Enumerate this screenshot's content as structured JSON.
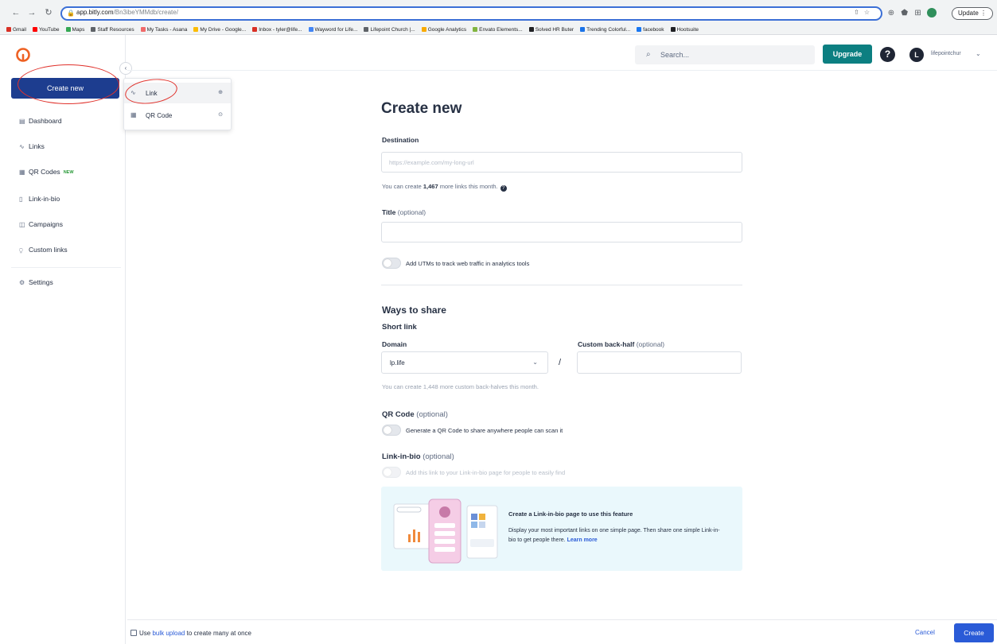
{
  "browser": {
    "url_host": "app.bitly.com",
    "url_path": "/Bn3ibeYMMdb/create/",
    "update_label": "Update",
    "bookmarks": [
      {
        "label": "Gmail",
        "color": "#d93025"
      },
      {
        "label": "YouTube",
        "color": "#ff0000"
      },
      {
        "label": "Maps",
        "color": "#34a853"
      },
      {
        "label": "Staff Resources",
        "color": "#5f6368"
      },
      {
        "label": "My Tasks - Asana",
        "color": "#f06a6a"
      },
      {
        "label": "My Drive - Google...",
        "color": "#fbbc04"
      },
      {
        "label": "Inbox - tyler@life...",
        "color": "#d93025"
      },
      {
        "label": "Wayword for Life...",
        "color": "#4285f4"
      },
      {
        "label": "Lifepoint Church |...",
        "color": "#5f6368"
      },
      {
        "label": "Google Analytics",
        "color": "#f9ab00"
      },
      {
        "label": "Envato Elements...",
        "color": "#82b541"
      },
      {
        "label": "Solved HR Buter",
        "color": "#202124"
      },
      {
        "label": "Trending Colorful...",
        "color": "#1a73e8"
      },
      {
        "label": "facebook",
        "color": "#1877f2"
      },
      {
        "label": "Hootsuite",
        "color": "#202124"
      }
    ]
  },
  "header": {
    "search_placeholder": "Search...",
    "upgrade_label": "Upgrade",
    "help_glyph": "?",
    "avatar_initial": "L",
    "account_name": "lifepointchur"
  },
  "sidebar": {
    "create_label": "Create new",
    "items": [
      {
        "label": "Dashboard",
        "icon": "▤"
      },
      {
        "label": "Links",
        "icon": "∿"
      },
      {
        "label": "QR Codes",
        "icon": "▦",
        "badge": "NEW"
      },
      {
        "label": "Link-in-bio",
        "icon": "▯"
      },
      {
        "label": "Campaigns",
        "icon": "◫"
      },
      {
        "label": "Custom links",
        "icon": "⍜"
      },
      {
        "label": "Settings",
        "icon": "⚙"
      }
    ]
  },
  "create_menu": {
    "items": [
      {
        "label": "Link",
        "icon": "∿",
        "shortcut": "⊕"
      },
      {
        "label": "QR Code",
        "icon": "▦",
        "shortcut": "⊙"
      }
    ]
  },
  "form": {
    "title": "Create new",
    "destination_label": "Destination",
    "destination_placeholder": "https://example.com/my-long-url",
    "destination_helper_pre": "You can create ",
    "destination_helper_count": "1,467",
    "destination_helper_post": " more links this month.",
    "title_label": "Title",
    "title_optional": "(optional)",
    "utm_toggle_label": "Add UTMs to track web traffic in analytics tools",
    "ways_to_share": "Ways to share",
    "short_link": "Short link",
    "domain_label": "Domain",
    "domain_value": "lp.life",
    "slash": "/",
    "backhalf_label": "Custom back-half",
    "backhalf_optional": "(optional)",
    "backhalf_helper": "You can create 1,448 more custom back-halves this month.",
    "qr_label": "QR Code",
    "qr_optional": "(optional)",
    "qr_toggle_label": "Generate a QR Code to share anywhere people can scan it",
    "lib_label": "Link-in-bio",
    "lib_optional": "(optional)",
    "lib_toggle_label": "Add this link to your Link-in-bio page for people to easily find",
    "promo_title": "Create a Link-in-bio page to use this feature",
    "promo_body": "Display your most important links on one simple page. Then share one simple Link-in-bio to get people there.",
    "promo_link": "Learn more"
  },
  "footer": {
    "use": "Use ",
    "bulk_link": "bulk upload",
    "rest": " to create many at once",
    "cancel_label": "Cancel",
    "create_label": "Create"
  },
  "colors": {
    "brand_blue": "#1d3d8f",
    "upgrade_teal": "#0c7f81",
    "primary_button": "#2a5bd7",
    "annotation_red": "#e0312b",
    "logo_orange": "#ee6123"
  }
}
